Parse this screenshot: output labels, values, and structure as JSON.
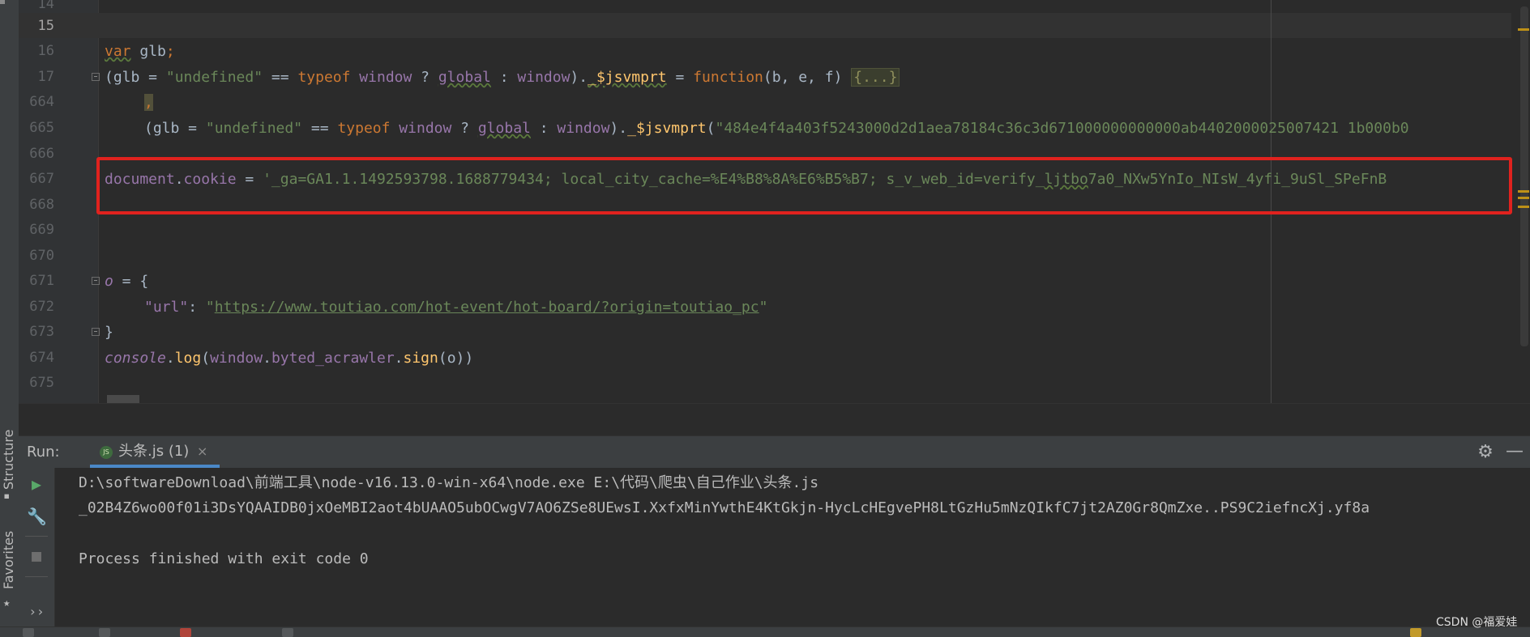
{
  "editor": {
    "lines": [
      {
        "num": "14"
      },
      {
        "num": "15"
      },
      {
        "num": "16"
      },
      {
        "num": "17"
      },
      {
        "num": "664"
      },
      {
        "num": "665"
      },
      {
        "num": "666"
      },
      {
        "num": "667"
      },
      {
        "num": "668"
      },
      {
        "num": "669"
      },
      {
        "num": "670"
      },
      {
        "num": "671"
      },
      {
        "num": "672"
      },
      {
        "num": "673"
      },
      {
        "num": "674"
      },
      {
        "num": "675"
      }
    ],
    "code": {
      "l16_kw": "var",
      "l16_rest": " glb",
      "l16_semi": ";",
      "l17_open": "(glb = ",
      "l17_str": "\"undefined\"",
      "l17_eq": " == ",
      "l17_typeof": "typeof",
      "l17_window1": " window",
      "l17_q": " ? ",
      "l17_global": "global",
      "l17_colon": " : ",
      "l17_window2": "window",
      "l17_close": ").",
      "l17_fn": "_$jsvmprt",
      "l17_assign": " = ",
      "l17_function": "function",
      "l17_params": "(b, e, f) ",
      "l17_fold": "{...}",
      "l664_comma": ",",
      "l665_open": "(glb = ",
      "l665_str": "\"undefined\"",
      "l665_eq": " == ",
      "l665_typeof": "typeof",
      "l665_window1": " window",
      "l665_q": " ? ",
      "l665_global": "global",
      "l665_colon": " : ",
      "l665_window2": "window",
      "l665_close": ").",
      "l665_fn": "_$jsvmprt",
      "l665_paren": "(",
      "l665_hex": "\"484e4f4a403f5243000d2d1aea78184c36c3d671000000000000ab4402000025007421 1b000b0",
      "l667_doc": "document",
      "l667_dot": ".",
      "l667_cookie": "cookie",
      "l667_assign": " = ",
      "l667_str_a": "'_ga=GA1.1.1492593798.1688779434; local_city_cache=%E4%B8%8A%E6%B5%B7; s_v_web_id=verify_",
      "l667_str_b": "ljtbo",
      "l667_str_c": "7a0_NXw5YnIo_NIsW_4yfi_9uSl_SPeFnB",
      "l671_o": "o",
      "l671_rest": " = {",
      "l672_key": "\"url\"",
      "l672_colon": ": ",
      "l672_q1": "\"",
      "l672_url": "https://www.toutiao.com/hot-event/hot-board/?origin=toutiao_pc",
      "l672_q2": "\"",
      "l673": "}",
      "l674_console": "console",
      "l674_dot1": ".",
      "l674_log": "log",
      "l674_p1": "(",
      "l674_window": "window",
      "l674_dot2": ".",
      "l674_byted": "byted_acrawler",
      "l674_dot3": ".",
      "l674_sign": "sign",
      "l674_p2": "(o))"
    }
  },
  "left_strip": {
    "structure": "Structure",
    "favorites": "Favorites"
  },
  "run_panel": {
    "label": "Run:",
    "tab_name": "头条.js (1)",
    "tab_icon": "JS",
    "close": "×",
    "console": [
      "D:\\softwareDownload\\前端工具\\node-v16.13.0-win-x64\\node.exe E:\\代码\\爬虫\\自己作业\\头条.js",
      "_02B4Z6wo00f01i3DsYQAAIDB0jxOeMBI2aot4bUAAO5ubOCwgV7AO6ZSe8UEwsI.XxfxMinYwthE4KtGkjn-HycLcHEgvePH8LtGzHu5mNzQIkfC7jt2AZ0Gr8QmZxe..PS9C2iefncXj.yf8a",
      "",
      "Process finished with exit code 0"
    ],
    "more": "››"
  },
  "watermark": "CSDN @福爱娃",
  "colors": {
    "keyword": "#cc7832",
    "string": "#6a8759",
    "function": "#ffc66d",
    "property": "#9876aa",
    "annotation_box": "#e0221e",
    "run_tab_underline": "#4a88c7"
  }
}
